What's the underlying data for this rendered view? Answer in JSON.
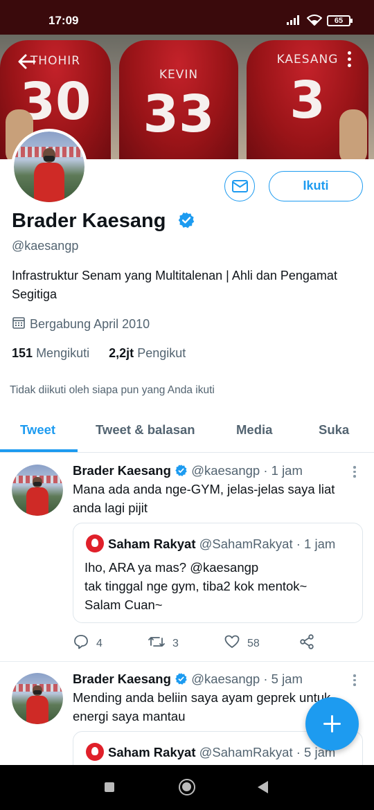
{
  "status_bar": {
    "time": "17:09",
    "battery": "65",
    "icons": [
      "signal-icon",
      "wifi-icon",
      "battery-icon"
    ]
  },
  "banner": {
    "jerseys": [
      {
        "name": "THOHIR",
        "number": "30"
      },
      {
        "name": "KEVIN",
        "number": "33"
      },
      {
        "name": "KAESANG",
        "number": "3"
      }
    ]
  },
  "profile": {
    "display_name": "Brader Kaesang",
    "handle": "@kaesangp",
    "bio": "Infrastruktur Senam yang Multitalenan | Ahli dan Pengamat Segitiga",
    "joined": "Bergabung April 2010",
    "following_count": "151",
    "following_label": "Mengikuti",
    "followers_count": "2,2jt",
    "followers_label": "Pengikut",
    "not_followed_note": "Tidak diikuti oleh siapa pun yang Anda ikuti",
    "follow_button": "Ikuti"
  },
  "tabs": [
    {
      "label": "Tweet",
      "active": true
    },
    {
      "label": "Tweet & balasan",
      "active": false
    },
    {
      "label": "Media",
      "active": false
    },
    {
      "label": "Suka",
      "active": false
    }
  ],
  "tweets": [
    {
      "author": "Brader Kaesang",
      "handle": "@kaesangp",
      "time": "· 1 jam",
      "text": "Mana ada anda nge-GYM, jelas-jelas saya liat anda lagi pijit",
      "quote": {
        "author": "Saham Rakyat",
        "handle": "@SahamRakyat",
        "time": "· 1 jam",
        "lines": [
          "Iho, ARA ya mas? @kaesangp",
          "tak tinggal nge gym, tiba2 kok mentok~",
          "Salam Cuan~"
        ]
      },
      "replies": "4",
      "retweets": "3",
      "likes": "58"
    },
    {
      "author": "Brader Kaesang",
      "handle": "@kaesangp",
      "time": "· 5 jam",
      "text": "Mending anda beliin saya ayam geprek untuk energi saya mantau",
      "quote": {
        "author": "Saham Rakyat",
        "handle": "@SahamRakyat",
        "time": "· 5 jam"
      }
    }
  ],
  "colors": {
    "accent": "#1d9bf0",
    "status_bar": "#3a0a0c",
    "secondary_text": "#536471"
  }
}
